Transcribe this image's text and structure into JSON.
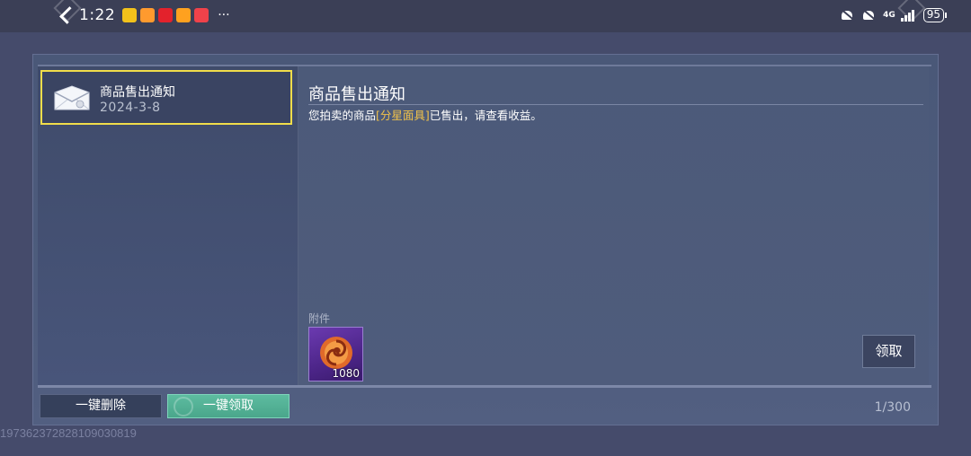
{
  "status_bar": {
    "time": "1:22",
    "more": "···",
    "network": "4G",
    "battery": "95"
  },
  "mail_list": {
    "items": [
      {
        "title": "商品售出通知",
        "date": "2024-3-8",
        "selected": true
      }
    ]
  },
  "mail_detail": {
    "title": "商品售出通知",
    "body_prefix": "您拍卖的商品",
    "item_name": "[分星面具]",
    "body_suffix": "已售出，请查看收益。",
    "attachments_label": "附件",
    "attachment_count": "1080",
    "claim_label": "领取"
  },
  "footer": {
    "delete_all_label": "一键删除",
    "claim_all_label": "一键领取",
    "mail_count": "1/300",
    "player_id": "1973623728281090308​19"
  },
  "colors": {
    "selected_border": "#f1dd4a",
    "item_name": "#f1c24a",
    "claim_all_bg": "#5dbca0"
  }
}
